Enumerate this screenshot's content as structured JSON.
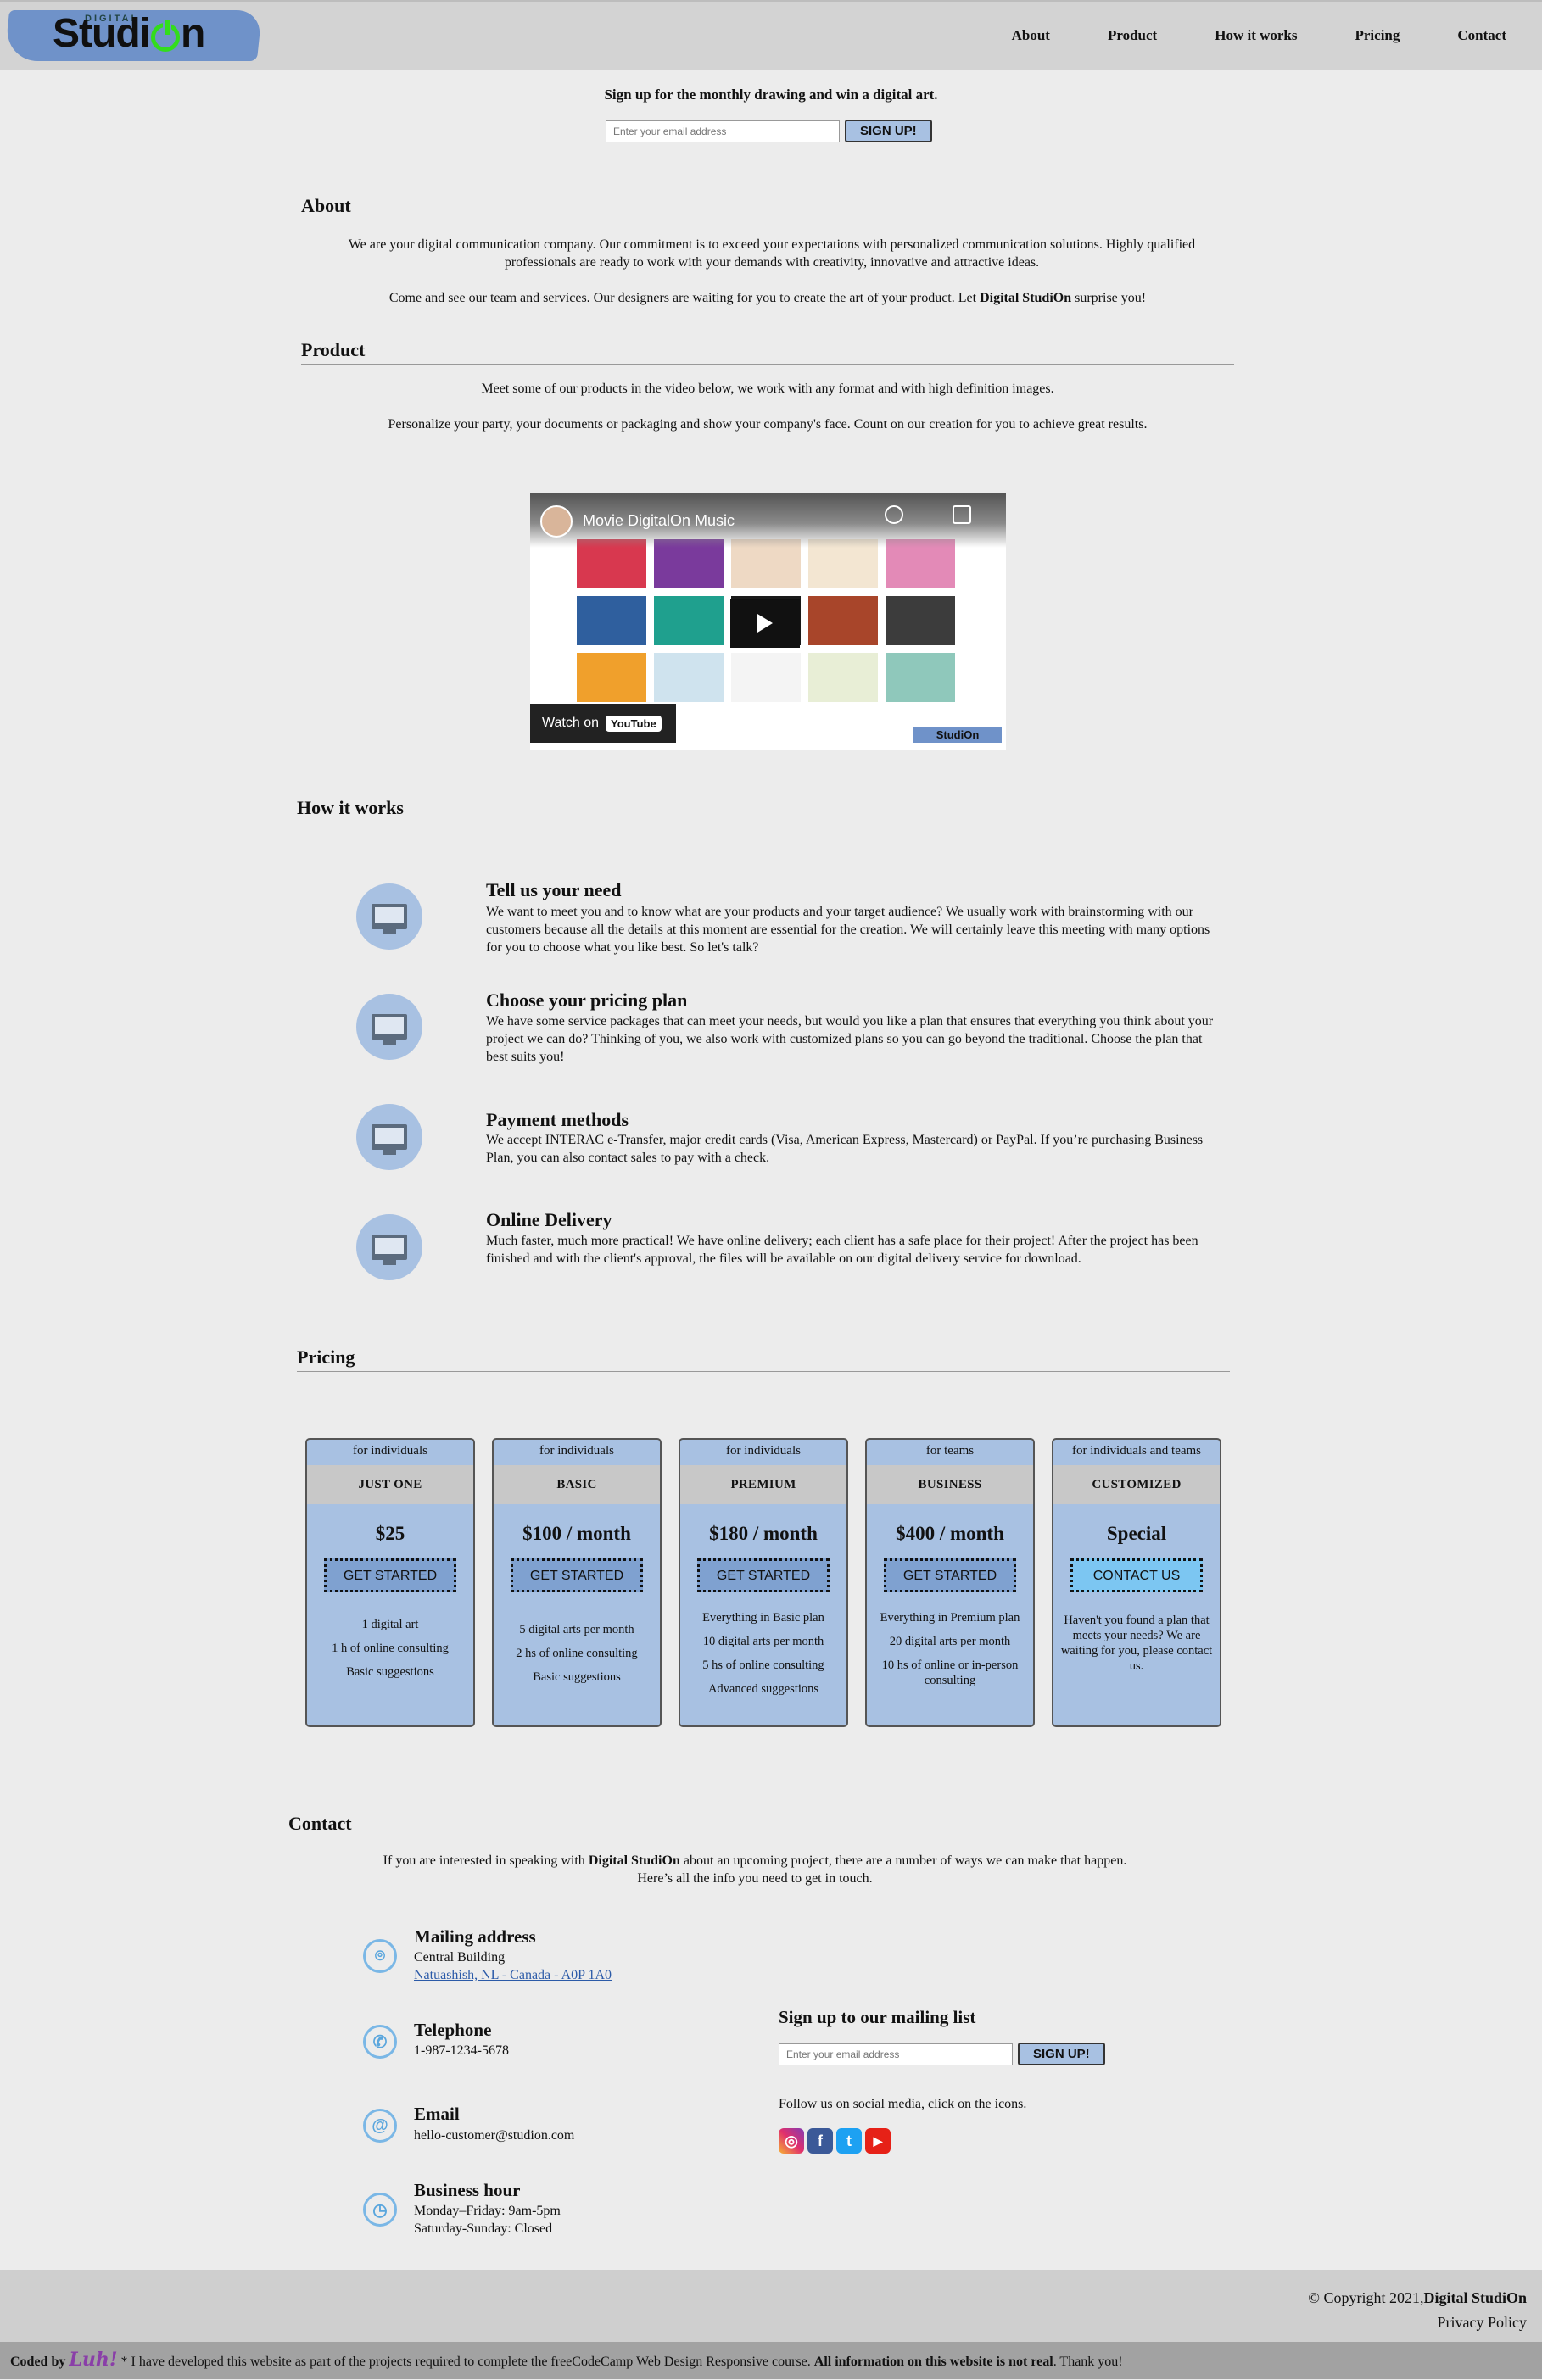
{
  "header": {
    "logo_small": "DIGITAL",
    "logo_left": "Studi",
    "logo_right": "n",
    "nav": [
      "About",
      "Product",
      "How it works",
      "Pricing",
      "Contact"
    ]
  },
  "top_signup": {
    "title": "Sign up for the monthly drawing and win a digital art.",
    "placeholder": "Enter your email address",
    "button": "SIGN UP!"
  },
  "about": {
    "title": "About",
    "p1": "We are your digital communication company. Our commitment is to exceed your expectations with personalized communication solutions. Highly qualified professionals are ready to work with your demands with creativity, innovative and attractive ideas.",
    "p2_pre": "Come and see our team and services. Our designers are waiting for you to create the art of your product. Let",
    "p2_brand_a": "Digital StudiO",
    "p2_brand_o": "n",
    "p2_post": "surprise you!"
  },
  "product": {
    "title": "Product",
    "p1": "Meet some of our products in the video below, we work with any format and with high definition images.",
    "p2": "Personalize your party, your documents or packaging and show your company's face. Count on our creation for you to achieve great results.",
    "video_title": "Movie DigitalOn Music",
    "watch_on": "Watch on",
    "youtube": "YouTube",
    "video_logo": "StudiOn",
    "card_colors": [
      "#d8384f",
      "#7a3a9c",
      "#eed9c4",
      "#f3e6d2",
      "#e38ab7",
      "#2f5f9e",
      "#1fa08e",
      "#1a1a1a",
      "#a8452a",
      "#3c3c3c",
      "#f0a02c",
      "#cfe3ee",
      "#f4f4f4",
      "#e8eed6",
      "#8fc8bb"
    ]
  },
  "how": {
    "title": "How it works",
    "steps": [
      {
        "title": "Tell us your need",
        "text": "We want to meet you and to know what are your products and your target audience? We usually work with brainstorming with our customers because all the details at this moment are essential for the creation. We will certainly leave this meeting with many options for you to choose what you like best. So let's talk?"
      },
      {
        "title": "Choose your pricing plan",
        "text": "We have some service packages that can meet your needs, but would you like a plan that ensures that everything you think about your project we can do? Thinking of you, we also work with customized plans so you can go beyond the traditional. Choose the plan that best suits you!"
      },
      {
        "title": "Payment methods",
        "text": "We accept INTERAC e-Transfer, major credit cards (Visa, American Express, Mastercard) or PayPal. If you’re purchasing Business Plan, you can also contact sales to pay with a check."
      },
      {
        "title": "Online Delivery",
        "text": "Much faster, much more practical! We have online delivery; each client has a safe place for their project! After the project has been finished and with the client's approval, the files will be available on our digital delivery service for download."
      }
    ]
  },
  "pricing": {
    "title": "Pricing",
    "plans": [
      {
        "who": "for individuals",
        "name": "JUST ONE",
        "price": "$25",
        "button": "GET STARTED",
        "features": [
          "1 digital art",
          "1 h of online consulting",
          "Basic suggestions"
        ]
      },
      {
        "who": "for individuals",
        "name": "BASIC",
        "price": "$100 / month",
        "button": "GET STARTED",
        "features": [
          "5 digital arts per month",
          "2 hs of online consulting",
          "Basic suggestions"
        ]
      },
      {
        "who": "for individuals",
        "name": "PREMIUM",
        "price": "$180 / month",
        "button": "GET STARTED",
        "features": [
          "Everything in Basic plan",
          "10 digital arts per month",
          "5 hs of online consulting",
          "Advanced suggestions"
        ]
      },
      {
        "who": "for teams",
        "name": "BUSINESS",
        "price": "$400 / month",
        "button": "GET STARTED",
        "features": [
          "Everything in Premium plan",
          "20 digital arts per month",
          "10 hs of online or in-person consulting"
        ]
      },
      {
        "who": "for individuals and teams",
        "name": "CUSTOMIZED",
        "price": "Special",
        "button": "CONTACT US",
        "features": [
          "Haven't you found a plan that meets your needs? We are waiting for you, please contact us."
        ]
      }
    ]
  },
  "contact": {
    "title": "Contact",
    "intro_pre": "If you are interested in speaking with",
    "intro_brand_a": "Digital StudiO",
    "intro_brand_o": "n",
    "intro_post": "about an upcoming project, there are a number of ways we can make that happen.",
    "intro_line2": "Here’s all the info you need to get in touch.",
    "mailing_title": "Mailing address",
    "mailing_line1": "Central Building",
    "mailing_link": "Natuashish, NL - Canada - A0P 1A0",
    "phone_title": "Telephone",
    "phone": "1-987-1234-5678",
    "email_title": "Email",
    "email": "hello-customer@studion.com",
    "hours_title": "Business hour",
    "hours_1": "Monday–Friday: 9am-5pm",
    "hours_2": "Saturday-Sunday: Closed",
    "list_title": "Sign up to our mailing list",
    "list_placeholder": "Enter your email address",
    "list_button": "SIGN UP!",
    "social_text": "Follow us on social media, click on the icons."
  },
  "footer": {
    "copyright_pre": "© Copyright 2021,",
    "copyright_brand": "Digital StudiO",
    "copyright_brand_end": "n",
    "privacy": "Privacy Policy",
    "coded_by": "Coded by",
    "signature": "Luh!",
    "note_pre": "* I have developed this website as part of the projects required to complete the freeCodeCamp Web Design Responsive course.",
    "note_bold": "All information on this website is not real",
    "note_post": ". Thank you!"
  }
}
